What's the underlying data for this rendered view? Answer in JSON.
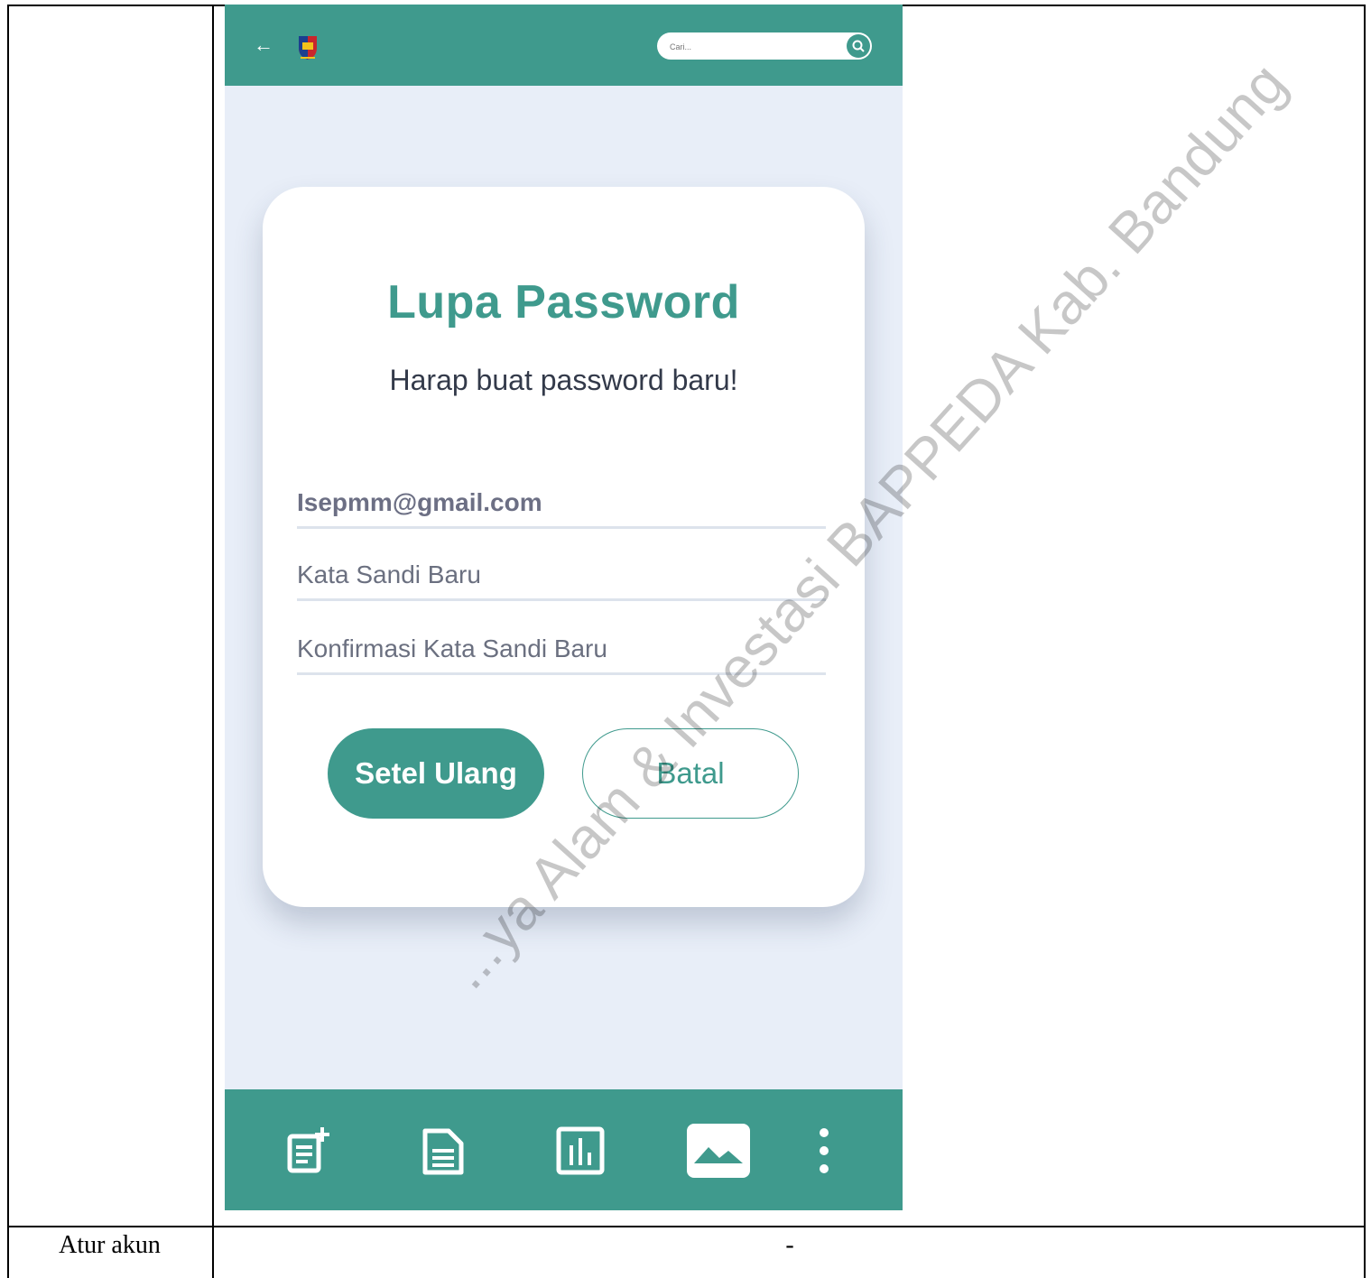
{
  "header": {
    "back_icon": "arrow-left-icon",
    "logo_icon": "regency-crest-logo",
    "search_placeholder": "Cari..."
  },
  "form": {
    "title": "Lupa Password",
    "subtitle": "Harap buat password baru!",
    "email_value": "Isepmm@gmail.com",
    "new_password_placeholder": "Kata Sandi Baru",
    "confirm_password_placeholder": "Konfirmasi Kata Sandi Baru",
    "reset_label": "Setel Ulang",
    "cancel_label": "Batal"
  },
  "bottom_nav": {
    "items": [
      "add-report-icon",
      "document-icon",
      "chart-icon",
      "image-icon",
      "more-vert-icon"
    ]
  },
  "table": {
    "row_label": "Atur akun",
    "row_value": "-"
  },
  "watermark": "...ya Alam & Investasi BAPPEDA Kab. Bandung",
  "colors": {
    "primary": "#3f9a8d",
    "background": "#e8eef8"
  }
}
